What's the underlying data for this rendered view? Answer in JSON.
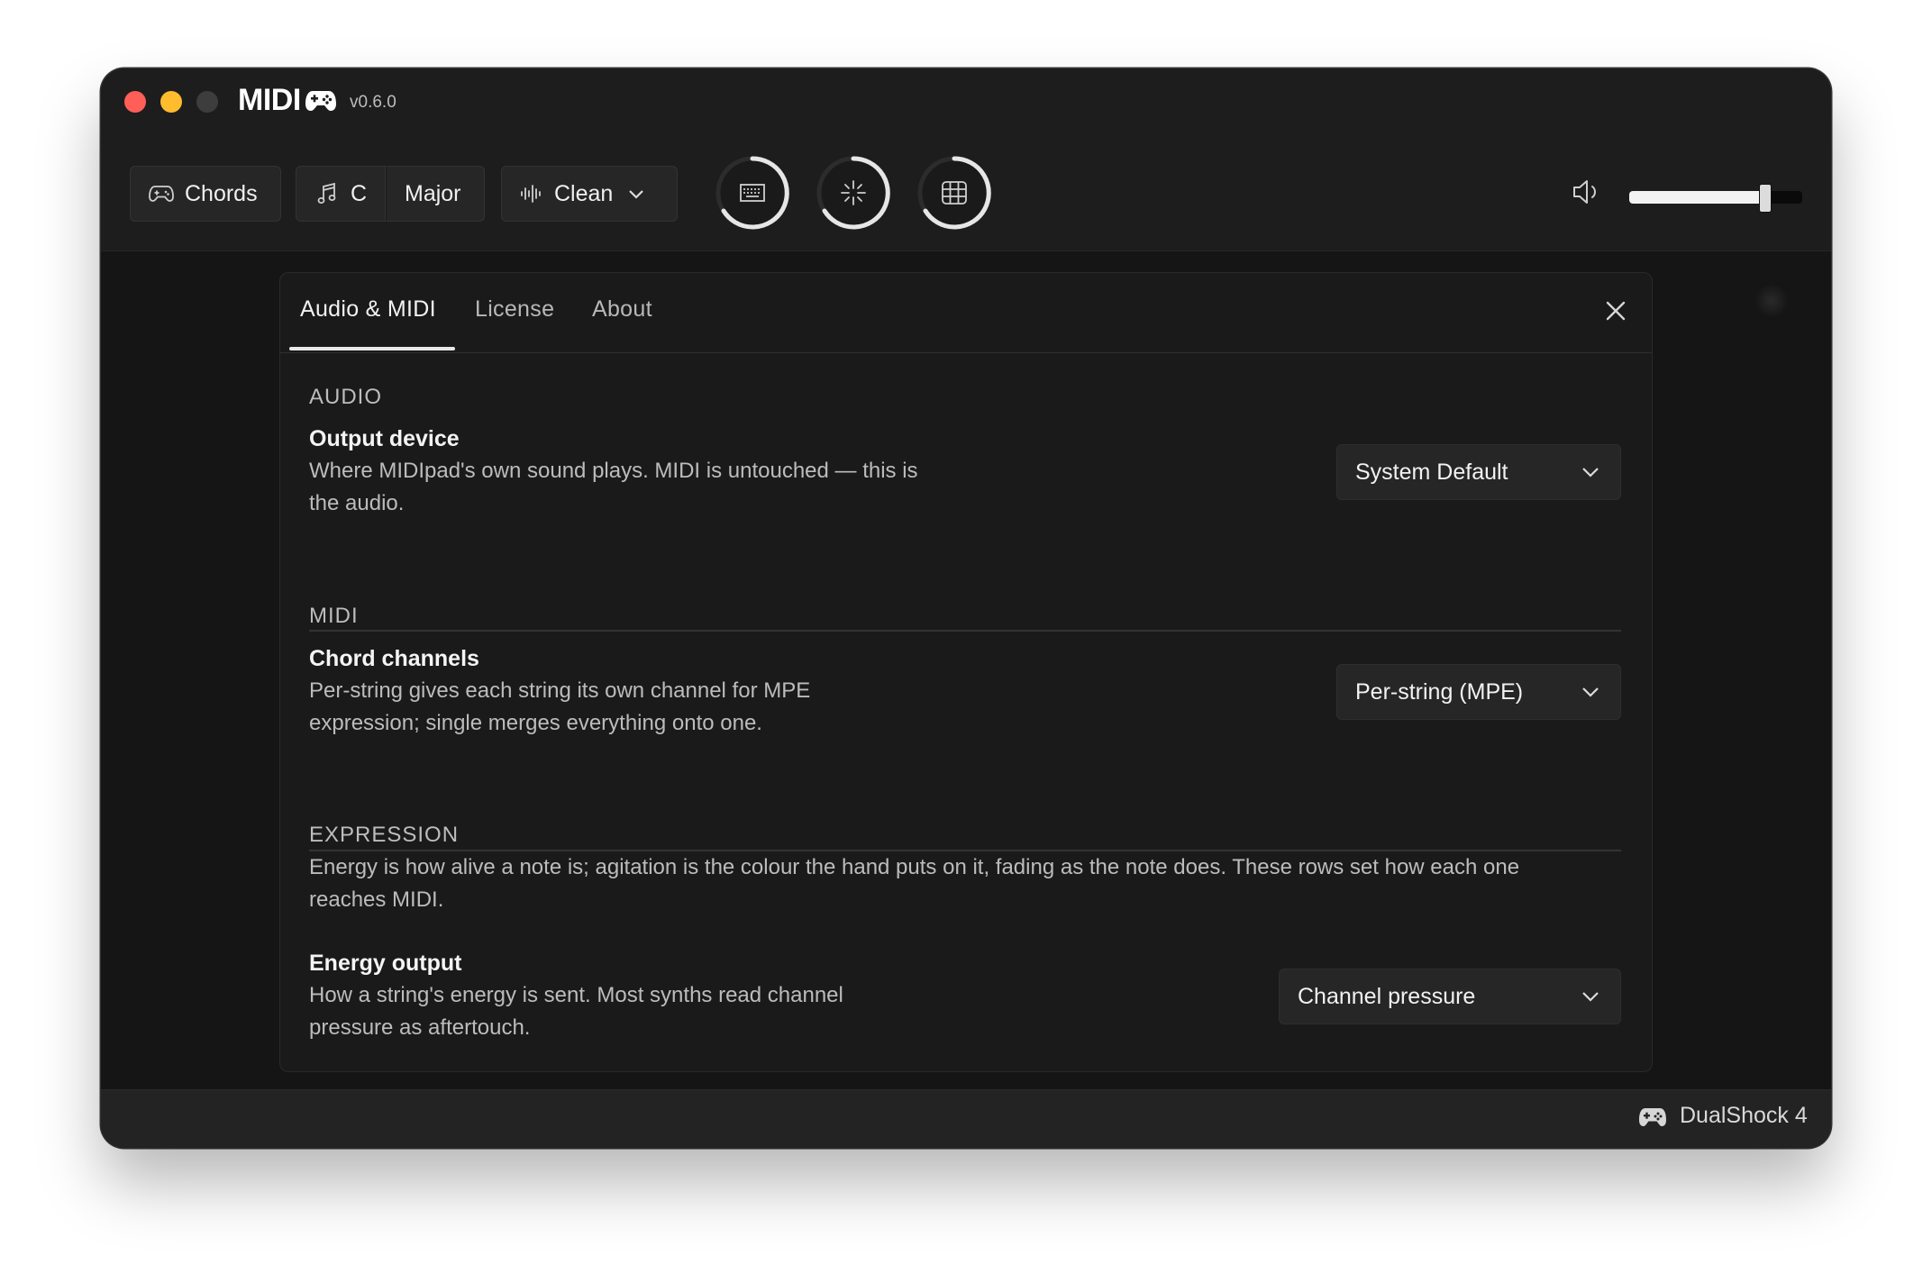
{
  "app": {
    "name": "MIDI",
    "version": "v0.6.0"
  },
  "toolbar": {
    "mode_label": "Chords",
    "key_label": "C",
    "scale_label": "Major",
    "sound_label": "Clean",
    "volume_percent": 78
  },
  "settings": {
    "tabs": [
      {
        "label": "Audio & MIDI"
      },
      {
        "label": "License"
      },
      {
        "label": "About"
      }
    ],
    "audio": {
      "section": "AUDIO",
      "output_title": "Output device",
      "output_desc_line1": "Where MIDIpad's own sound plays. MIDI is untouched —  this is",
      "output_desc_line2": "the audio.",
      "output_value": "System Default"
    },
    "midi": {
      "section": "MIDI",
      "channels_title": "Chord channels",
      "channels_desc_line1": "Per-string gives each string its own channel for MPE",
      "channels_desc_line2": "expression; single merges everything onto one.",
      "channels_value": "Per-string (MPE)"
    },
    "expression": {
      "section": "EXPRESSION",
      "intro_line1": "Energy is how alive a note is; agitation is the colour the hand puts on it, fading as the note does. These rows set how each one",
      "intro_line2": "reaches MIDI.",
      "energy_title": "Energy output",
      "energy_desc_line1": "How a string's energy is sent. Most synths read channel",
      "energy_desc_line2": "pressure as aftertouch.",
      "energy_value": "Channel pressure"
    }
  },
  "status": {
    "device": "DualShock 4"
  },
  "colors": {
    "close": "#ff5f57",
    "minimize": "#febc2e",
    "maximize": "#3d3d3d",
    "window_bg": "#151515"
  }
}
